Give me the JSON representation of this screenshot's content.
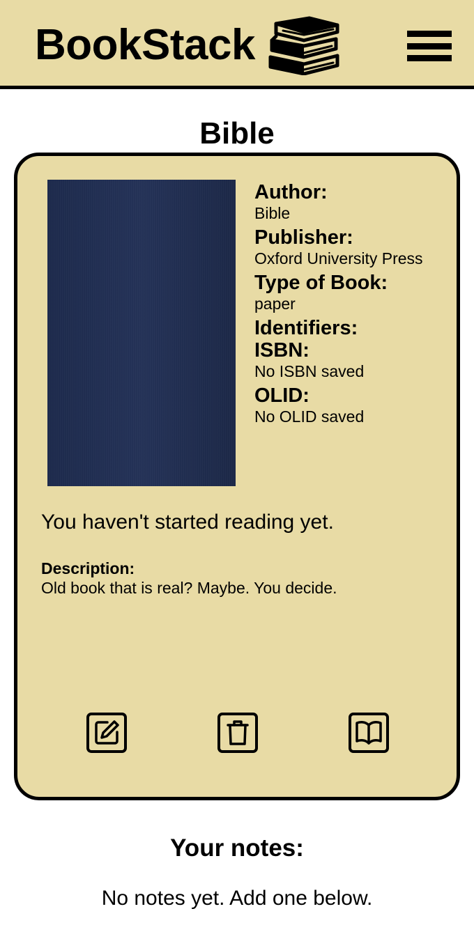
{
  "app": {
    "name": "BookStack",
    "logo_icon": "books-stack-icon",
    "menu_icon": "hamburger-menu-icon",
    "header_color": "#e8dba5"
  },
  "book": {
    "title": "Bible",
    "cover_color": "#1f2b4e",
    "details": {
      "author_label": "Author:",
      "author": "Bible",
      "publisher_label": "Publisher:",
      "publisher": "Oxford University Press",
      "type_label": "Type of Book:",
      "type": "paper",
      "identifiers_label": "Identifiers:",
      "isbn_label": "ISBN:",
      "isbn": "No ISBN saved",
      "olid_label": "OLID:",
      "olid": "No OLID saved"
    },
    "reading_status": "You haven't started reading yet.",
    "description_label": "Description:",
    "description": "Old book that is real? Maybe. You decide."
  },
  "actions": {
    "edit_icon": "edit-icon",
    "delete_icon": "trash-icon",
    "read_icon": "open-book-icon"
  },
  "notes": {
    "heading": "Your notes:",
    "empty_text": "No notes yet. Add one below."
  }
}
